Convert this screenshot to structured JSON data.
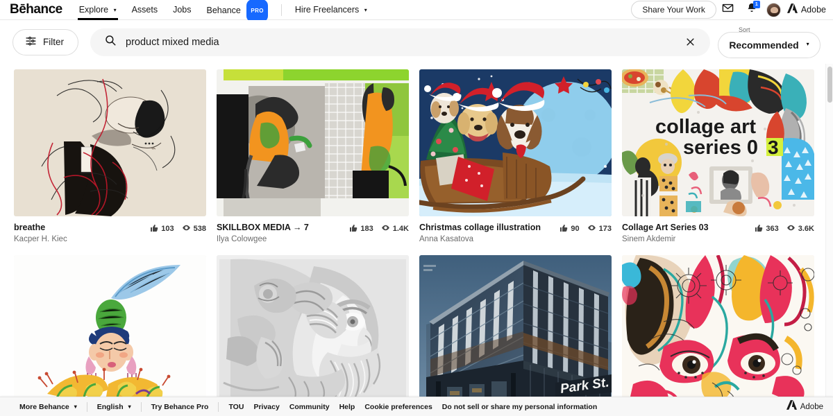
{
  "nav": {
    "logo": "Bēhance",
    "items": [
      {
        "label": "Explore",
        "caret": true,
        "active": true
      },
      {
        "label": "Assets",
        "caret": false,
        "active": false
      },
      {
        "label": "Jobs",
        "caret": false,
        "active": false
      },
      {
        "label": "Behance",
        "caret": false,
        "active": false,
        "badge": "PRO"
      },
      {
        "label": "Hire Freelancers",
        "caret": true,
        "active": false
      }
    ],
    "share_label": "Share Your Work",
    "mail_icon": "envelope-icon",
    "bell_icon": "bell-icon",
    "bell_badge": "1",
    "avatar_icon": "user-avatar",
    "adobe_label": "Adobe"
  },
  "search": {
    "filter_label": "Filter",
    "filter_icon": "sliders-icon",
    "search_icon": "search-icon",
    "query": "product mixed media",
    "placeholder": "Search",
    "clear_icon": "close-icon",
    "sort_caption": "Sort",
    "sort_value": "Recommended"
  },
  "colors": {
    "accent": "#1769ff",
    "text": "#191919",
    "muted": "#6b6b6b",
    "chrome": "#f5f5f5"
  },
  "projects": [
    {
      "title": "breathe",
      "owner": "Kacper H. Kiec",
      "likes": "103",
      "views": "538",
      "art": "sketch-portrait"
    },
    {
      "title": "SKILLBOX MEDIA → 7",
      "owner": "Ilya Colowgee",
      "likes": "183",
      "views": "1.4K",
      "art": "green-collage"
    },
    {
      "title": "Christmas collage illustration",
      "owner": "Anna Kasatova",
      "likes": "90",
      "views": "173",
      "art": "christmas-dogs"
    },
    {
      "title": "Collage Art Series 03",
      "owner": "Sinem Akdemir",
      "likes": "363",
      "views": "3.6K",
      "art": "collage-series"
    },
    {
      "title": "",
      "owner": "",
      "likes": "",
      "views": "",
      "art": "crayon-figure"
    },
    {
      "title": "",
      "owner": "",
      "likes": "",
      "views": "",
      "art": "marble-bust"
    },
    {
      "title": "",
      "owner": "",
      "likes": "",
      "views": "",
      "art": "park-st-building"
    },
    {
      "title": "",
      "owner": "",
      "likes": "",
      "views": "",
      "art": "colorful-faces"
    }
  ],
  "footer": {
    "more_behance": "More Behance",
    "language": "English",
    "try_pro": "Try Behance Pro",
    "links": [
      "TOU",
      "Privacy",
      "Community",
      "Help",
      "Cookie preferences",
      "Do not sell or share my personal information"
    ],
    "adobe_label": "Adobe"
  }
}
